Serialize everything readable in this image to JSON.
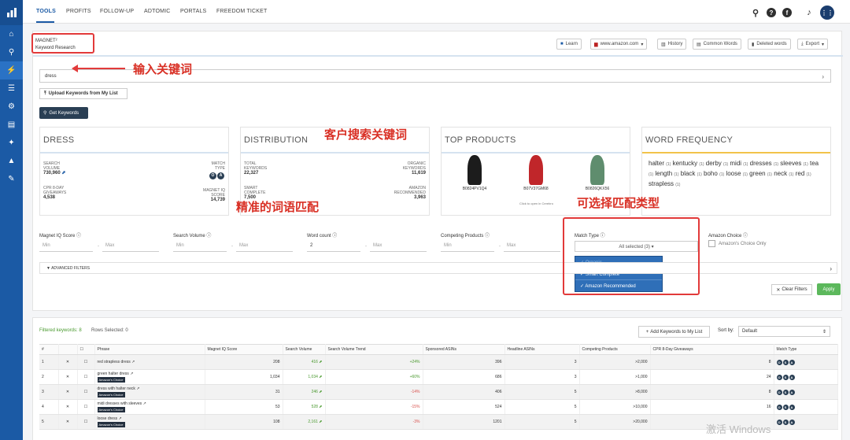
{
  "nav": {
    "items": [
      "TOOLS",
      "PROFITS",
      "FOLLOW-UP",
      "ADTOMIC",
      "PORTALS",
      "FREEDOM TICKET"
    ]
  },
  "tool": {
    "title": "MAGNET²",
    "subtitle": "Keyword Research"
  },
  "toolbar": {
    "learn": "Learn",
    "marketplace": "www.amazon.com",
    "history": "History",
    "common": "Common Words",
    "deleted": "Deleted words",
    "export": "Export"
  },
  "keyword": {
    "value": "dress",
    "upload": "Upload Keywords from My List",
    "get": "Get Keywords"
  },
  "summary": {
    "title": "DRESS",
    "search_volume_label": "SEARCH VOLUME",
    "search_volume": "730,960",
    "match_type_label": "MATCH TYPE",
    "cpr_label": "CPR 8-DAY GIVEAWAYS",
    "cpr": "4,538",
    "iq_label": "MAGNET IQ SCORE",
    "iq": "14,739"
  },
  "distribution": {
    "title": "DISTRIBUTION",
    "total_label": "TOTAL KEYWORDS",
    "total": "22,327",
    "organic_label": "ORGANIC KEYWORDS",
    "organic": "11,619",
    "smart_label": "SMART COMPLETE",
    "smart": "7,500",
    "amazon_label": "AMAZON RECOMMENDED",
    "amazon": "3,963"
  },
  "top_products": {
    "title": "TOP PRODUCTS",
    "asins": [
      "B0824PV1Q4",
      "B07V37GM68",
      "B0826QKX56"
    ],
    "note": "Click to open in Cerebro"
  },
  "word_frequency": {
    "title": "WORD FREQUENCY",
    "words": [
      {
        "w": "halter",
        "n": "(1)"
      },
      {
        "w": "kentucky",
        "n": "(1)"
      },
      {
        "w": "derby",
        "n": "(1)"
      },
      {
        "w": "midi",
        "n": "(1)"
      },
      {
        "w": "dresses",
        "n": "(1)"
      },
      {
        "w": "sleeves",
        "n": "(1)"
      },
      {
        "w": "tea",
        "n": "(1)"
      },
      {
        "w": "length",
        "n": "(1)"
      },
      {
        "w": "black",
        "n": "(1)"
      },
      {
        "w": "boho",
        "n": "(1)"
      },
      {
        "w": "loose",
        "n": "(1)"
      },
      {
        "w": "green",
        "n": "(1)"
      },
      {
        "w": "neck",
        "n": "(1)"
      },
      {
        "w": "red",
        "n": "(1)"
      },
      {
        "w": "strapless",
        "n": "(1)"
      }
    ]
  },
  "filters": {
    "iq": "Magnet IQ Score",
    "sv": "Search Volume",
    "wc": "Word count",
    "cp": "Competing Products",
    "mt": "Match Type",
    "ac": "Amazon Choice",
    "min": "Min",
    "max": "Max",
    "wc_min": "2",
    "mt_selected": "All selected (3)",
    "mt_options": [
      "Organic",
      "Smart Complete",
      "Amazon Recommended"
    ],
    "ac_only": "Amazon's Choice Only",
    "advanced": "ADVANCED FILTERS",
    "clear": "Clear Filters",
    "apply": "Apply"
  },
  "results": {
    "filtered": "Filtered keywords: 8",
    "rows_selected": "Rows Selected: 0",
    "add": "Add Keywords to My List",
    "sort_label": "Sort by:",
    "sort_value": "Default",
    "columns": [
      "#",
      "",
      "",
      "Phrase",
      "Magnet IQ Score",
      "Search Volume",
      "Search Volume Trend",
      "Sponsored ASINs",
      "Headline ASINs",
      "Competing Products",
      "CPR 8-Day Giveaways",
      "Match Type"
    ],
    "badge": "Amazon's Choice",
    "rows": [
      {
        "n": "1",
        "phrase": "red strapless dress",
        "iq": "208",
        "sv": "416",
        "trend": "+24%",
        "sp": "396",
        "hl": "3",
        "cp": ">2,000",
        "cpr": "8",
        "ac": false
      },
      {
        "n": "2",
        "phrase": "green halter dress",
        "iq": "1,034",
        "sv": "1,034",
        "trend": "+60%",
        "sp": "686",
        "hl": "3",
        "cp": ">1,000",
        "cpr": "24",
        "ac": true
      },
      {
        "n": "3",
        "phrase": "dress with halter neck",
        "iq": "31",
        "sv": "246",
        "trend": "-14%",
        "sp": "406",
        "hl": "5",
        "cp": ">8,000",
        "cpr": "8",
        "ac": true
      },
      {
        "n": "4",
        "phrase": "midi dresses with sleeves",
        "iq": "53",
        "sv": "528",
        "trend": "-15%",
        "sp": "524",
        "hl": "5",
        "cp": ">10,000",
        "cpr": "16",
        "ac": true
      },
      {
        "n": "5",
        "phrase": "loose dress",
        "iq": "108",
        "sv": "2,161",
        "trend": "-3%",
        "sp": "1201",
        "hl": "5",
        "cp": ">20,000",
        "cpr": "",
        "ac": true
      }
    ]
  },
  "annotations": {
    "a1": "输入关键词",
    "a2": "客户搜索关键词",
    "a3": "精准的词语匹配",
    "a4": "可选择匹配类型"
  },
  "watermark": "激活 Windows"
}
